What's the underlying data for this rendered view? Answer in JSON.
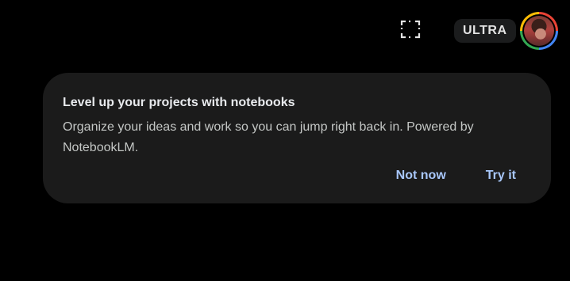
{
  "header": {
    "screenshot_icon": "screenshot-selection-icon",
    "plan_badge": "ULTRA",
    "avatar_icon": "account-avatar"
  },
  "promo_card": {
    "title": "Level up your projects with notebooks",
    "body": "Organize your ideas and work so you can jump right back in. Powered by NotebookLM.",
    "dismiss_label": "Not now",
    "confirm_label": "Try it"
  },
  "colors": {
    "background": "#000000",
    "card_background": "#1b1b1b",
    "action_text": "#a8c7fa",
    "badge_background": "#1b1c1d"
  }
}
